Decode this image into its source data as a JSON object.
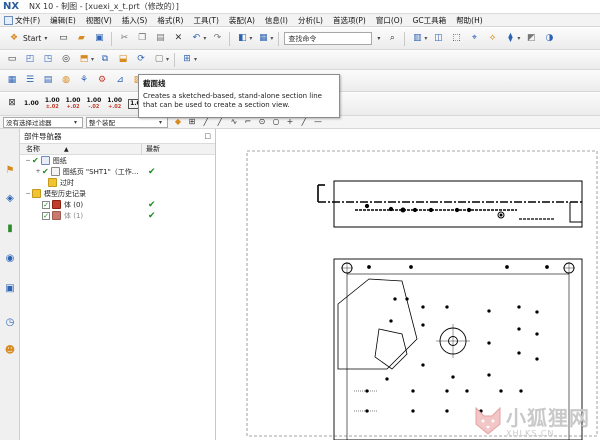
{
  "titlebar": {
    "logo": "NX",
    "title": "NX 10 - 制图 - [xuexi_x_t.prt（修改的）]"
  },
  "menu": [
    {
      "label": "文件(F)"
    },
    {
      "label": "编辑(E)"
    },
    {
      "label": "视图(V)"
    },
    {
      "label": "插入(S)"
    },
    {
      "label": "格式(R)"
    },
    {
      "label": "工具(T)"
    },
    {
      "label": "装配(A)"
    },
    {
      "label": "信息(I)"
    },
    {
      "label": "分析(L)"
    },
    {
      "label": "首选项(P)"
    },
    {
      "label": "窗口(O)"
    },
    {
      "label": "GC工具箱"
    },
    {
      "label": "帮助(H)"
    }
  ],
  "toolbar": {
    "start_label": "Start",
    "command_search_placeholder": "查找命令"
  },
  "dimension_icons": [
    {
      "top": "1.00",
      "bottom": ""
    },
    {
      "top": "1.00",
      "bottom": "±.02"
    },
    {
      "top": "1.00",
      "bottom": "+.02"
    },
    {
      "top": "1.00",
      "bottom": "-.02"
    },
    {
      "top": "1.00",
      "bottom": "+.02"
    },
    {
      "top": "1.000",
      "bottom": ""
    }
  ],
  "filters": {
    "selection_filter": "没有选择过滤器",
    "assembly_scope": "整个装配"
  },
  "tooltip": {
    "title": "截面线",
    "body": "Creates a sketched-based, stand-alone section line that can be used to create a section view."
  },
  "navigator": {
    "title": "部件导航器",
    "col_name": "名称",
    "col_latest": "最新",
    "rows": [
      {
        "label": "图纸"
      },
      {
        "label": "图纸页 \"SHT1\"（工作..."
      },
      {
        "label": "过时"
      },
      {
        "label": "模型历史记录"
      },
      {
        "label": "体 (0)"
      },
      {
        "label": "体 (1)"
      }
    ]
  },
  "drawing": {
    "view_line_numbers": [],
    "section_line_style": "dash-dot"
  },
  "watermark": {
    "cn": "小狐狸网",
    "en": "XHLKS.CN"
  },
  "colors": {
    "accent": "#2d63b5",
    "check_green": "#1d8a1d",
    "tooltip_border": "#8c8c8c"
  }
}
